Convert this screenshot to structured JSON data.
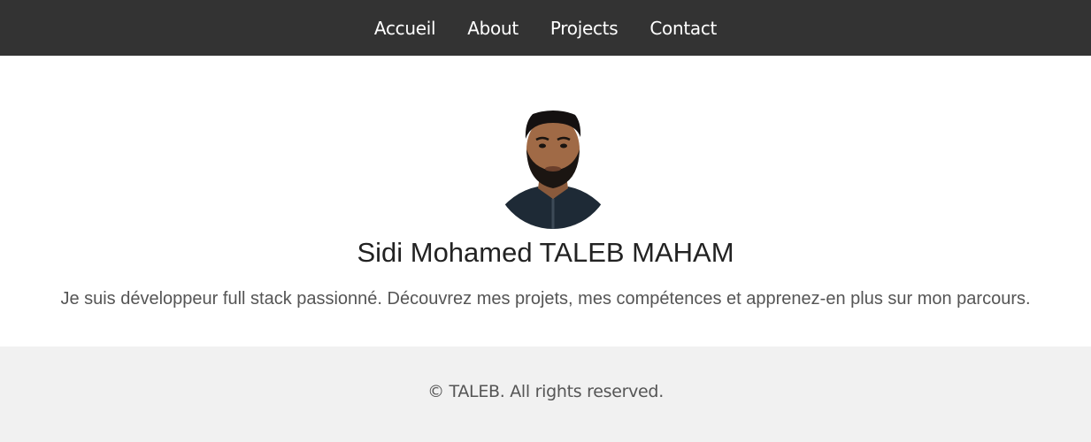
{
  "nav": {
    "items": [
      {
        "label": "Accueil"
      },
      {
        "label": "About"
      },
      {
        "label": "Projects"
      },
      {
        "label": "Contact"
      }
    ]
  },
  "hero": {
    "name": "Sidi Mohamed TALEB MAHAM",
    "bio": "Je suis développeur full stack passionné. Découvrez mes projets, mes compétences et apprenez-en plus sur mon parcours."
  },
  "footer": {
    "text": "© TALEB. All rights reserved."
  },
  "colors": {
    "navbar_bg": "#333333",
    "footer_bg": "#f1f1f1",
    "name_text": "#222222",
    "muted_text": "#555555"
  }
}
